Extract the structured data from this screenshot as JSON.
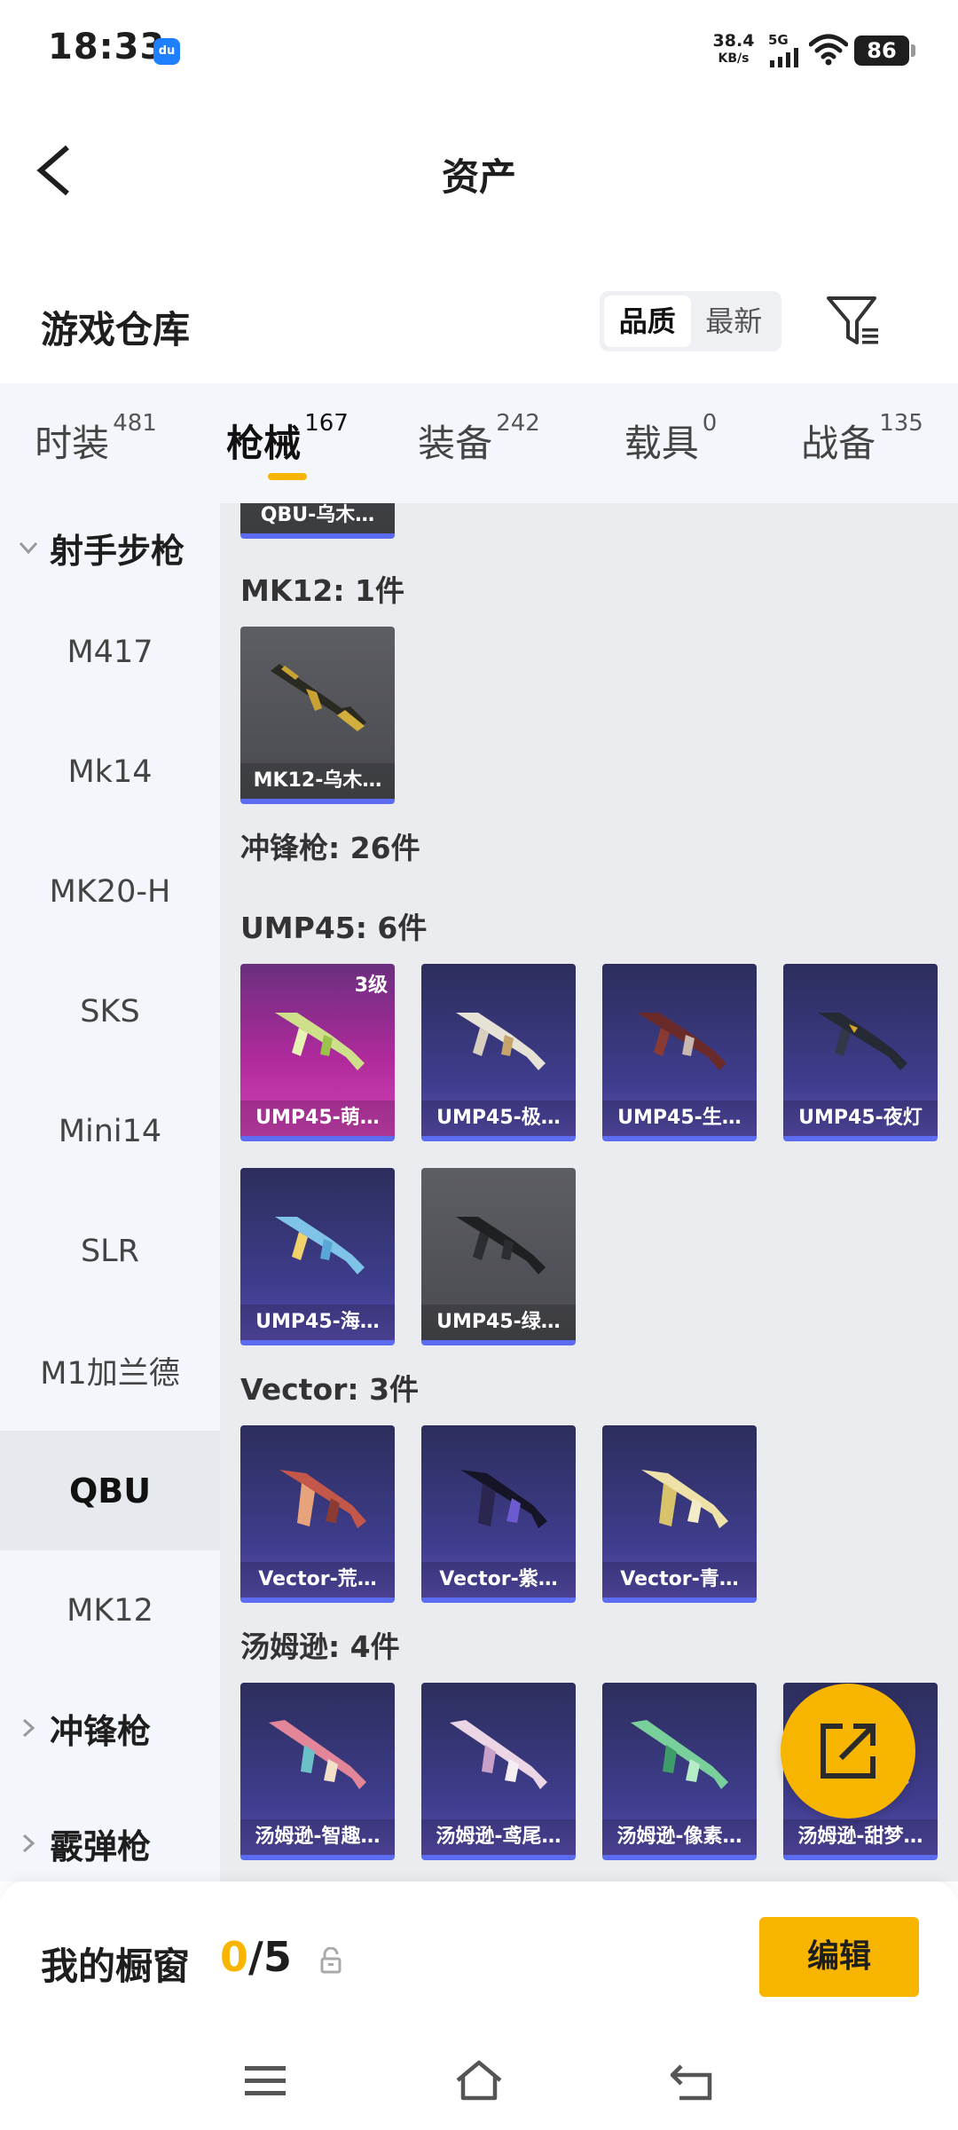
{
  "status": {
    "time": "18:33",
    "app_icon": "du",
    "speed_value": "38.4",
    "speed_unit": "KB/s",
    "network": "5G",
    "battery": "86"
  },
  "header": {
    "title": "资产"
  },
  "warehouse": {
    "title": "游戏仓库",
    "sort": [
      "品质",
      "最新"
    ],
    "active_sort": "品质"
  },
  "tabs": [
    {
      "label": "时装",
      "count": "481"
    },
    {
      "label": "枪械",
      "count": "167",
      "active": true
    },
    {
      "label": "装备",
      "count": "242"
    },
    {
      "label": "载具",
      "count": "0"
    },
    {
      "label": "战备",
      "count": "135"
    }
  ],
  "sidebar": {
    "group_open": "射手步枪",
    "items": [
      "M417",
      "Mk14",
      "MK20-H",
      "SKS",
      "Mini14",
      "SLR",
      "M1加兰德",
      "QBU",
      "MK12"
    ],
    "active_item": "QBU",
    "group_smg": "冲锋枪",
    "group_shotgun": "霰弹枪"
  },
  "content": {
    "top_card": "QBU-乌木…",
    "mk12_header": "MK12: 1件",
    "mk12_cards": [
      "MK12-乌木…"
    ],
    "smg_header": "冲锋枪: 26件",
    "ump_header": "UMP45: 6件",
    "ump_cards": [
      {
        "name": "UMP45-萌…",
        "level": "3级"
      },
      {
        "name": "UMP45-极…"
      },
      {
        "name": "UMP45-生…"
      },
      {
        "name": "UMP45-夜灯"
      },
      {
        "name": "UMP45-海…"
      },
      {
        "name": "UMP45-绿…"
      }
    ],
    "vector_header": "Vector: 3件",
    "vector_cards": [
      "Vector-荒…",
      "Vector-紫…",
      "Vector-青…"
    ],
    "tommy_header": "汤姆逊: 4件",
    "tommy_cards": [
      "汤姆逊-智趣…",
      "汤姆逊-鸢尾…",
      "汤姆逊-像素…",
      "汤姆逊-甜梦…"
    ]
  },
  "bottom": {
    "label": "我的橱窗",
    "current": "0",
    "total": "/5",
    "edit": "编辑"
  },
  "colors": {
    "accent": "#f7b500",
    "card_gray": "#56575c",
    "card_purple": "#3f3d8e",
    "card_pink": "#c236a8",
    "card_border": "#5b6cf0"
  },
  "icons": {
    "back": "back-arrow-icon",
    "filter": "filter-icon",
    "share": "share-icon",
    "lock": "lock-icon",
    "menu": "menu-icon",
    "home": "home-icon",
    "back_nav": "back-nav-icon"
  }
}
